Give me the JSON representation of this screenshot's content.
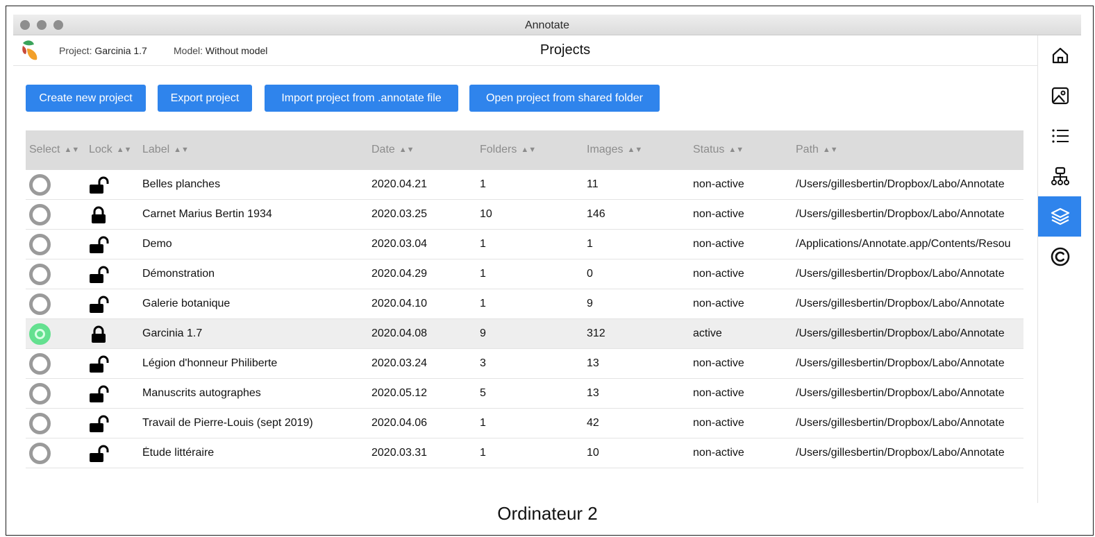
{
  "window": {
    "title": "Annotate"
  },
  "topbar": {
    "project_label": "Project:",
    "project_value": "Garcinia 1.7",
    "model_label": "Model:",
    "model_value": "Without model",
    "page_title": "Projects"
  },
  "toolbar": {
    "create_label": "Create new project",
    "export_label": "Export project",
    "import_label": "Import project from .annotate file",
    "open_shared_label": "Open project from shared folder"
  },
  "table": {
    "headers": [
      "Select",
      "Lock",
      "Label",
      "Date",
      "Folders",
      "Images",
      "Status",
      "Path"
    ],
    "rows": [
      {
        "locked": false,
        "selected": false,
        "label": "Belles planches",
        "date": "2020.04.21",
        "folders": "1",
        "images": "11",
        "status": "non-active",
        "path": "/Users/gillesbertin/Dropbox/Labo/Annotate"
      },
      {
        "locked": true,
        "selected": false,
        "label": "Carnet Marius Bertin 1934",
        "date": "2020.03.25",
        "folders": "10",
        "images": "146",
        "status": "non-active",
        "path": "/Users/gillesbertin/Dropbox/Labo/Annotate"
      },
      {
        "locked": false,
        "selected": false,
        "label": "Demo",
        "date": "2020.03.04",
        "folders": "1",
        "images": "1",
        "status": "non-active",
        "path": "/Applications/Annotate.app/Contents/Resources"
      },
      {
        "locked": false,
        "selected": false,
        "label": "Démonstration",
        "date": "2020.04.29",
        "folders": "1",
        "images": "0",
        "status": "non-active",
        "path": "/Users/gillesbertin/Dropbox/Labo/Annotate"
      },
      {
        "locked": false,
        "selected": false,
        "label": "Galerie botanique",
        "date": "2020.04.10",
        "folders": "1",
        "images": "9",
        "status": "non-active",
        "path": "/Users/gillesbertin/Dropbox/Labo/Annotate"
      },
      {
        "locked": true,
        "selected": true,
        "label": "Garcinia 1.7",
        "date": "2020.04.08",
        "folders": "9",
        "images": "312",
        "status": "active",
        "path": "/Users/gillesbertin/Dropbox/Labo/Annotate"
      },
      {
        "locked": false,
        "selected": false,
        "label": "Légion d'honneur Philiberte",
        "date": "2020.03.24",
        "folders": "3",
        "images": "13",
        "status": "non-active",
        "path": "/Users/gillesbertin/Dropbox/Labo/Annotate"
      },
      {
        "locked": false,
        "selected": false,
        "label": "Manuscrits autographes",
        "date": "2020.05.12",
        "folders": "5",
        "images": "13",
        "status": "non-active",
        "path": "/Users/gillesbertin/Dropbox/Labo/Annotate"
      },
      {
        "locked": false,
        "selected": false,
        "label": "Travail de Pierre-Louis (sept 2019)",
        "date": "2020.04.06",
        "folders": "1",
        "images": "42",
        "status": "non-active",
        "path": "/Users/gillesbertin/Dropbox/Labo/Annotate"
      },
      {
        "locked": false,
        "selected": false,
        "label": "Étude littéraire",
        "date": "2020.03.31",
        "folders": "1",
        "images": "10",
        "status": "non-active",
        "path": "/Users/gillesbertin/Dropbox/Labo/Annotate"
      }
    ]
  },
  "sidebar": {
    "items": [
      {
        "icon": "home-icon"
      },
      {
        "icon": "image-icon"
      },
      {
        "icon": "list-icon"
      },
      {
        "icon": "hierarchy-icon"
      },
      {
        "icon": "layers-icon",
        "selected": true
      },
      {
        "icon": "copyright-icon"
      }
    ]
  },
  "colors": {
    "accent": "#2f84ec",
    "active_radio": "#63e08f",
    "header_bg": "#dcdcdc"
  },
  "caption": "Ordinateur 2"
}
